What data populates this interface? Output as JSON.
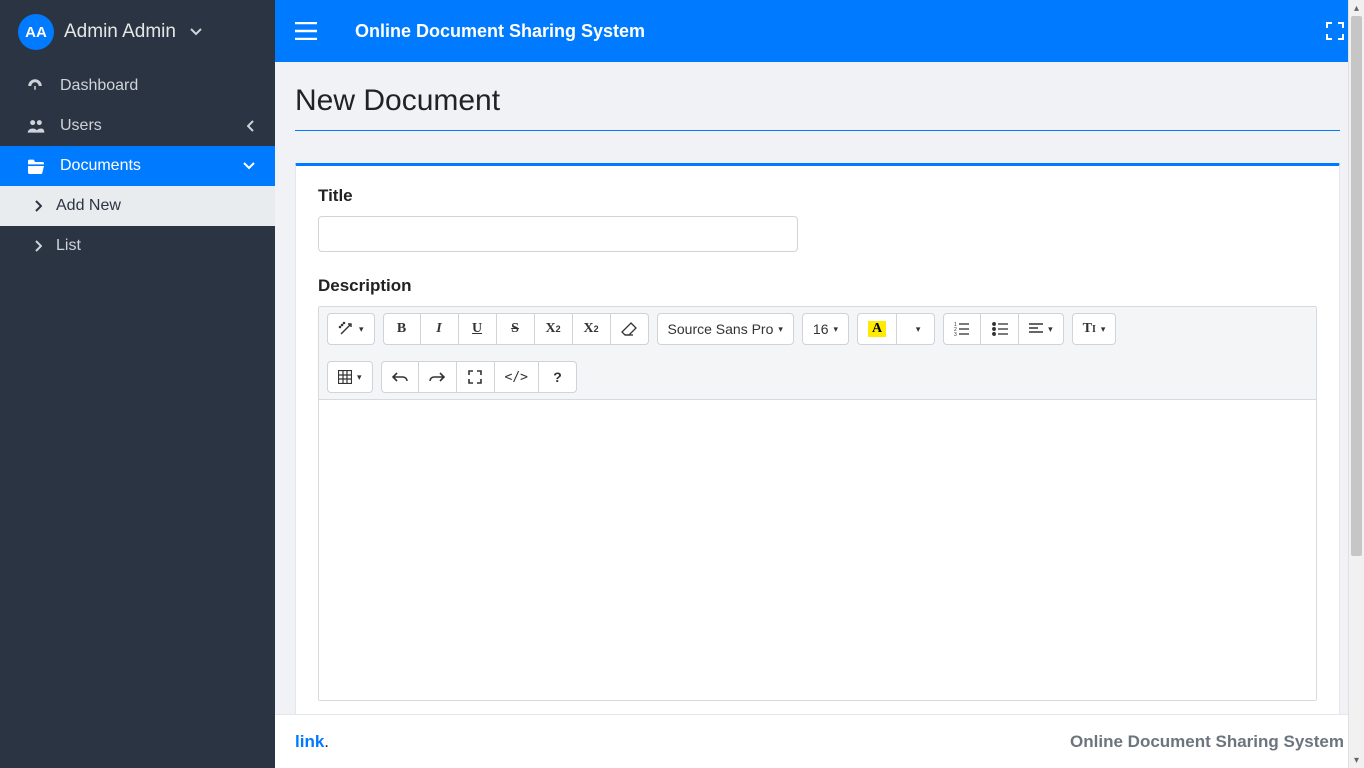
{
  "user": {
    "initials": "AA",
    "name": "Admin Admin"
  },
  "sidebar": {
    "dashboard": "Dashboard",
    "users": "Users",
    "documents": "Documents",
    "add_new": "Add New",
    "list": "List"
  },
  "header": {
    "brand": "Online Document Sharing System"
  },
  "page": {
    "title": "New Document",
    "title_label": "Title",
    "title_value": "",
    "description_label": "Description"
  },
  "editor": {
    "font_family": "Source Sans Pro",
    "font_size": "16",
    "buttons": {
      "bold": "B",
      "italic": "I",
      "underline": "U",
      "strike": "S",
      "super": "x",
      "sub": "x",
      "eraser": "",
      "colorA": "A",
      "code": "</>",
      "question": "?",
      "heading": "T"
    }
  },
  "footer": {
    "link_text": "link",
    "right_text": "Online Document Sharing System"
  }
}
